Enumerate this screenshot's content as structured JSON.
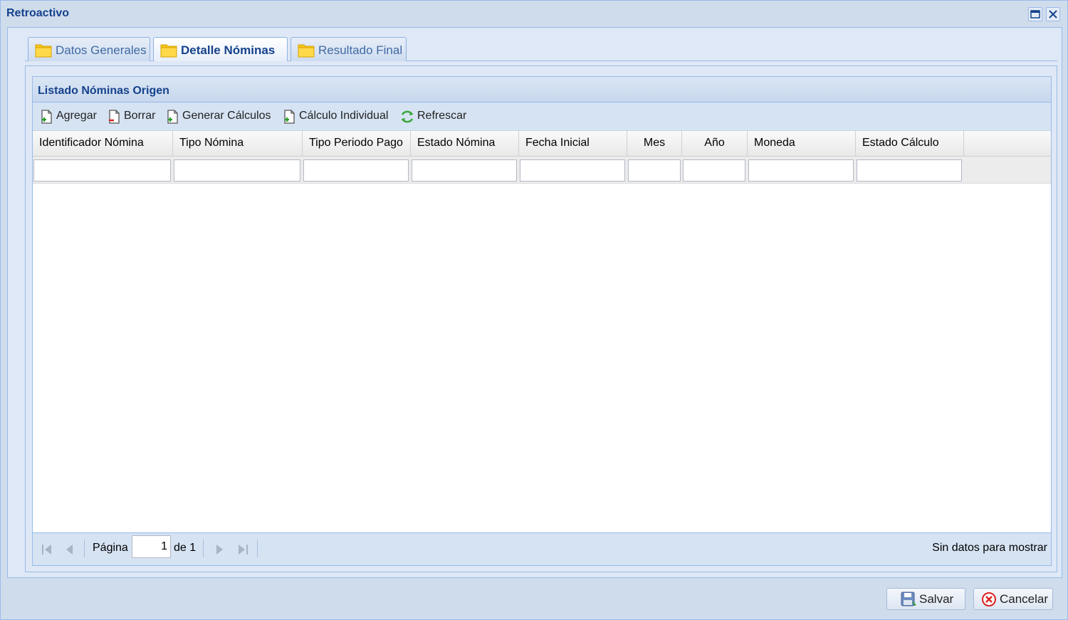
{
  "window": {
    "title": "Retroactivo"
  },
  "tabs": [
    {
      "label": "Datos Generales",
      "active": false
    },
    {
      "label": "Detalle Nóminas",
      "active": true
    },
    {
      "label": "Resultado Final",
      "active": false
    }
  ],
  "panel": {
    "title": "Listado Nóminas Origen"
  },
  "toolbar": {
    "add": "Agregar",
    "delete": "Borrar",
    "generate": "Generar Cálculos",
    "individual": "Cálculo Individual",
    "refresh": "Refrescar"
  },
  "grid": {
    "columns": [
      "Identificador Nómina",
      "Tipo Nómina",
      "Tipo Periodo Pago",
      "Estado Nómina",
      "Fecha Inicial",
      "Mes",
      "Año",
      "Moneda",
      "Estado Cálculo"
    ],
    "rows": []
  },
  "pager": {
    "page_label": "Página",
    "page_value": "1",
    "of_label": "de 1",
    "status": "Sin datos para mostrar"
  },
  "buttons": {
    "save": "Salvar",
    "cancel": "Cancelar"
  },
  "colors": {
    "title": "#15428b",
    "border": "#99bbe8",
    "window_bg": "#cfdcec"
  }
}
